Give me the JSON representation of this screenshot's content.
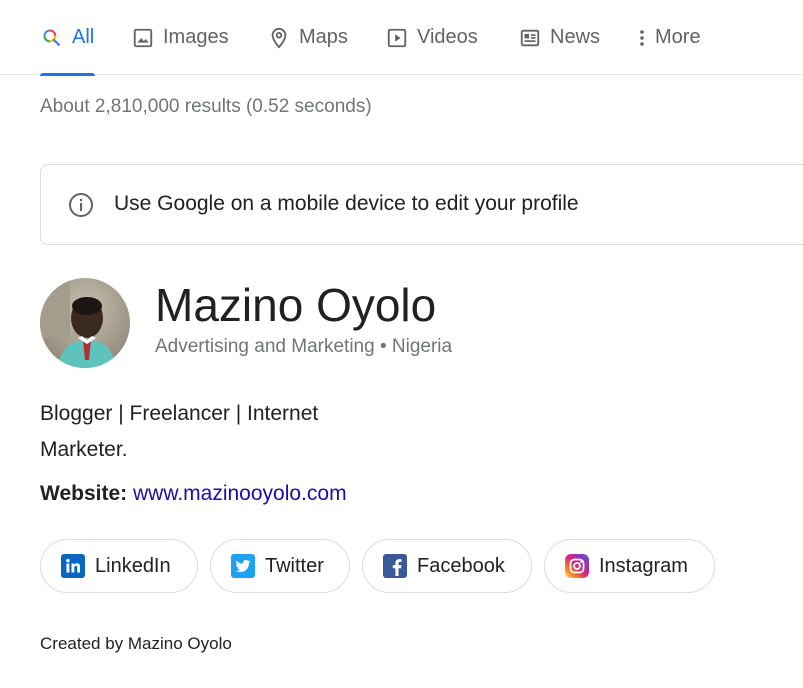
{
  "tabs": [
    {
      "label": "All",
      "icon": "search-multicolor-icon",
      "active": true
    },
    {
      "label": "Images",
      "icon": "image-icon"
    },
    {
      "label": "Maps",
      "icon": "map-pin-icon"
    },
    {
      "label": "Videos",
      "icon": "play-icon"
    },
    {
      "label": "News",
      "icon": "newspaper-icon"
    },
    {
      "label": "More",
      "icon": "more-vert-icon"
    }
  ],
  "result_stats": "About 2,810,000 results (0.52 seconds)",
  "notice": {
    "icon": "info-icon",
    "text": "Use Google on a mobile device to edit your profile"
  },
  "profile": {
    "name": "Mazino Oyolo",
    "subtitle": "Advertising and Marketing • Nigeria",
    "bio_line1": "Blogger | Freelancer | Internet",
    "bio_line2": "Marketer.",
    "website_label": "Website:",
    "website_url": "www.mazinooyolo.com"
  },
  "social": [
    {
      "label": "LinkedIn",
      "icon": "linkedin-icon",
      "color": "#0a66c2"
    },
    {
      "label": "Twitter",
      "icon": "twitter-icon",
      "color": "#1da1f2"
    },
    {
      "label": "Facebook",
      "icon": "facebook-icon",
      "color": "#3b5998"
    },
    {
      "label": "Instagram",
      "icon": "instagram-icon",
      "color": "#c13584"
    }
  ],
  "footer": "Created by Mazino Oyolo",
  "colors": {
    "accent": "#1a73e8",
    "link": "#1a0dab",
    "muted": "#70757a"
  }
}
